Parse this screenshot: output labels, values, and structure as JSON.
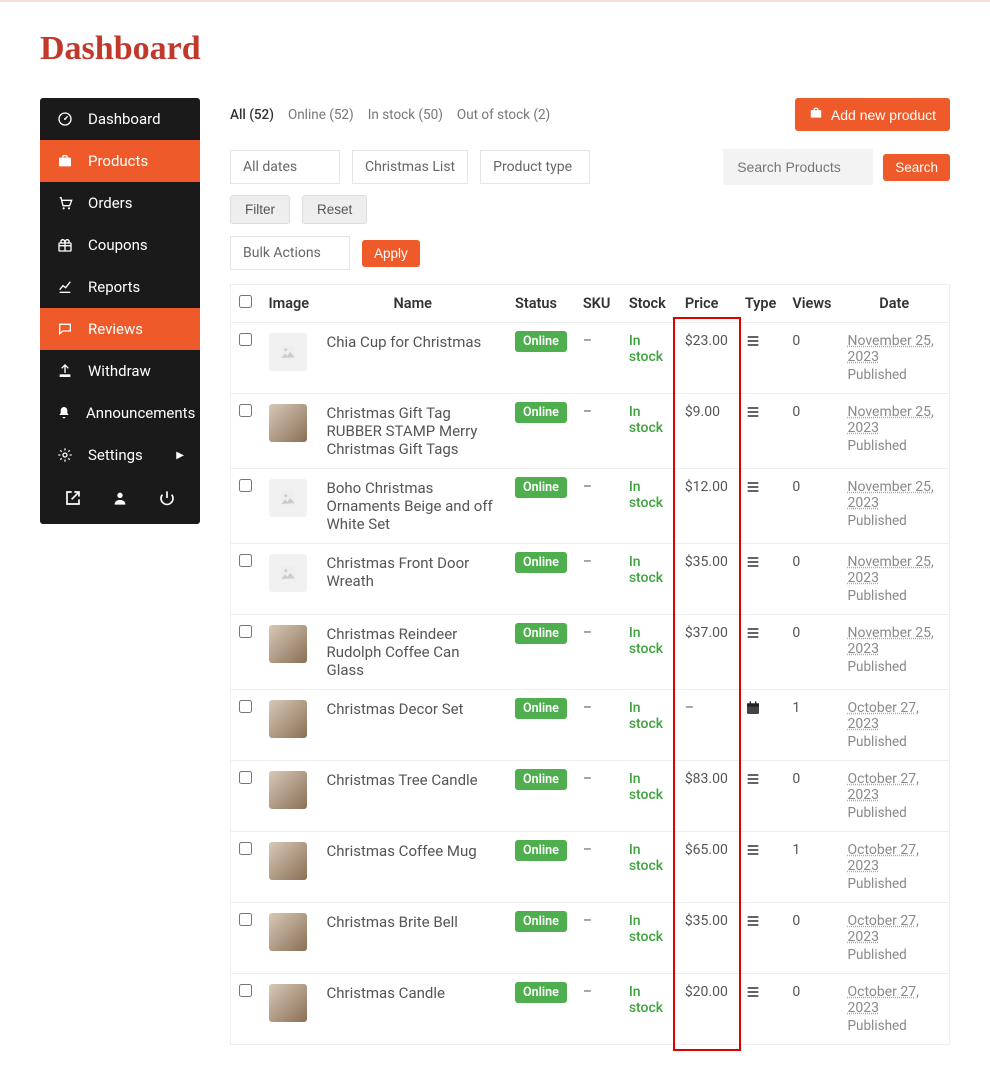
{
  "page_title": "Dashboard",
  "sidebar": {
    "items": [
      {
        "icon": "dashboard",
        "label": "Dashboard",
        "active": false
      },
      {
        "icon": "briefcase",
        "label": "Products",
        "active": true
      },
      {
        "icon": "cart",
        "label": "Orders",
        "active": false
      },
      {
        "icon": "gift",
        "label": "Coupons",
        "active": false
      },
      {
        "icon": "chart",
        "label": "Reports",
        "active": false
      },
      {
        "icon": "chat",
        "label": "Reviews",
        "active": true
      },
      {
        "icon": "upload",
        "label": "Withdraw",
        "active": false
      },
      {
        "icon": "bell",
        "label": "Announcements",
        "active": false
      },
      {
        "icon": "gear",
        "label": "Settings",
        "active": false,
        "chevron": true
      }
    ],
    "bottom_icons": [
      "external",
      "user",
      "power"
    ]
  },
  "status_filters": [
    {
      "label": "All (52)",
      "active": true
    },
    {
      "label": "Online (52)",
      "active": false
    },
    {
      "label": "In stock (50)",
      "active": false
    },
    {
      "label": "Out of stock (2)",
      "active": false
    }
  ],
  "add_button": "Add new product",
  "filters": {
    "date": "All dates",
    "category": "Christmas List",
    "type": "Product type",
    "filter_btn": "Filter",
    "reset_btn": "Reset",
    "search_placeholder": "Search Products",
    "search_btn": "Search"
  },
  "bulk": {
    "select": "Bulk Actions",
    "apply": "Apply"
  },
  "table": {
    "headers": {
      "image": "Image",
      "name": "Name",
      "status": "Status",
      "sku": "SKU",
      "stock": "Stock",
      "price": "Price",
      "type": "Type",
      "views": "Views",
      "date": "Date"
    },
    "rows": [
      {
        "img": false,
        "name": "Chia Cup for Christmas",
        "status": "Online",
        "sku": "–",
        "stock": "In stock",
        "price": "$23.00",
        "type": "list",
        "views": "0",
        "date": "November 25, 2023",
        "pub": "Published"
      },
      {
        "img": true,
        "name": "Christmas Gift Tag RUBBER STAMP Merry Christmas Gift Tags",
        "status": "Online",
        "sku": "–",
        "stock": "In stock",
        "price": "$9.00",
        "type": "list",
        "views": "0",
        "date": "November 25, 2023",
        "pub": "Published"
      },
      {
        "img": false,
        "name": "Boho Christmas Ornaments Beige and off White Set",
        "status": "Online",
        "sku": "–",
        "stock": "In stock",
        "price": "$12.00",
        "type": "list",
        "views": "0",
        "date": "November 25, 2023",
        "pub": "Published"
      },
      {
        "img": false,
        "name": "Christmas Front Door Wreath",
        "status": "Online",
        "sku": "–",
        "stock": "In stock",
        "price": "$35.00",
        "type": "list",
        "views": "0",
        "date": "November 25, 2023",
        "pub": "Published"
      },
      {
        "img": true,
        "name": "Christmas Reindeer Rudolph Coffee Can Glass",
        "status": "Online",
        "sku": "–",
        "stock": "In stock",
        "price": "$37.00",
        "type": "list",
        "views": "0",
        "date": "November 25, 2023",
        "pub": "Published"
      },
      {
        "img": true,
        "name": "Christmas Decor Set",
        "status": "Online",
        "sku": "–",
        "stock": "In stock",
        "price": "–",
        "type": "calendar",
        "views": "1",
        "date": "October 27, 2023",
        "pub": "Published"
      },
      {
        "img": true,
        "name": "Christmas Tree Candle",
        "status": "Online",
        "sku": "–",
        "stock": "In stock",
        "price": "$83.00",
        "type": "list",
        "views": "0",
        "date": "October 27, 2023",
        "pub": "Published"
      },
      {
        "img": true,
        "name": "Christmas Coffee Mug",
        "status": "Online",
        "sku": "–",
        "stock": "In stock",
        "price": "$65.00",
        "type": "list",
        "views": "1",
        "date": "October 27, 2023",
        "pub": "Published"
      },
      {
        "img": true,
        "name": "Christmas Brite Bell",
        "status": "Online",
        "sku": "–",
        "stock": "In stock",
        "price": "$35.00",
        "type": "list",
        "views": "0",
        "date": "October 27, 2023",
        "pub": "Published"
      },
      {
        "img": true,
        "name": "Christmas Candle",
        "status": "Online",
        "sku": "–",
        "stock": "In stock",
        "price": "$20.00",
        "type": "list",
        "views": "0",
        "date": "October 27, 2023",
        "pub": "Published"
      }
    ]
  }
}
